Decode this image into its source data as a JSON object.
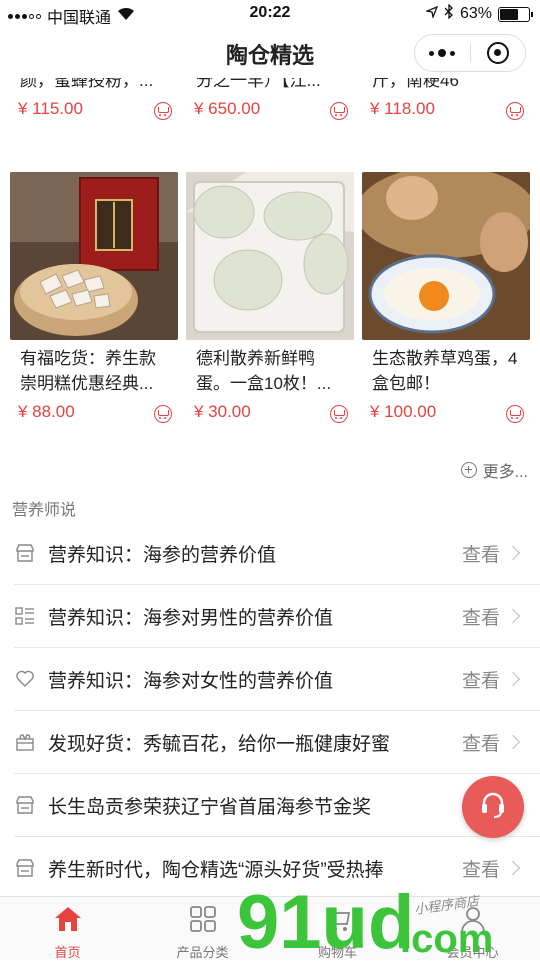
{
  "status": {
    "carrier": "中国联通",
    "time": "20:22",
    "battery": "63%",
    "battery_level": 0.63
  },
  "nav": {
    "title": "陶仓精选"
  },
  "products_row1": [
    {
      "title_line": "颜，蜜蜂授粉，...",
      "price": "¥ 115.00"
    },
    {
      "title_line": "分之一羊）【江...",
      "price": "¥ 650.00"
    },
    {
      "title_line": "斤，南粳46",
      "price": "¥ 118.00"
    }
  ],
  "products_row2": [
    {
      "title": "有福吃货：养生款崇明糕优惠经典...",
      "price": "¥ 88.00",
      "image": "崇明糕礼盒"
    },
    {
      "title": "德利散养新鲜鸭蛋。一盒10枚！...",
      "price": "¥ 30.00",
      "image": "鸭蛋"
    },
    {
      "title": "生态散养草鸡蛋，4盒包邮！",
      "price": "¥ 100.00",
      "image": "草鸡蛋"
    }
  ],
  "more_label": "更多...",
  "section_title": "营养师说",
  "articles": [
    {
      "text": "营养知识：海参的营养价值",
      "view": "查看",
      "icon": "store-icon"
    },
    {
      "text": "营养知识：海参对男性的营养价值",
      "view": "查看",
      "icon": "list-icon"
    },
    {
      "text": "营养知识：海参对女性的营养价值",
      "view": "查看",
      "icon": "heart-icon"
    },
    {
      "text": "发现好货：秀毓百花，给你一瓶健康好蜜",
      "view": "查看",
      "icon": "gift-icon"
    },
    {
      "text": "长生岛贡参荣获辽宁省首届海参节金奖",
      "view": "查看",
      "icon": "store-icon"
    },
    {
      "text": "养生新时代，陶仓精选“源头好货”受热捧",
      "view": "查看",
      "icon": "store-icon"
    }
  ],
  "tabs": [
    {
      "label": "首页",
      "icon": "home-icon"
    },
    {
      "label": "产品分类",
      "icon": "grid-icon"
    },
    {
      "label": "购物车",
      "icon": "cart-icon"
    },
    {
      "label": "会员中心",
      "icon": "user-icon"
    }
  ],
  "watermark": {
    "brand": "91ud.com",
    "tagline": "小程序商店"
  },
  "colors": {
    "accent": "#e64340",
    "fab": "#e85b58",
    "watermark_green": "#3cc43a"
  }
}
